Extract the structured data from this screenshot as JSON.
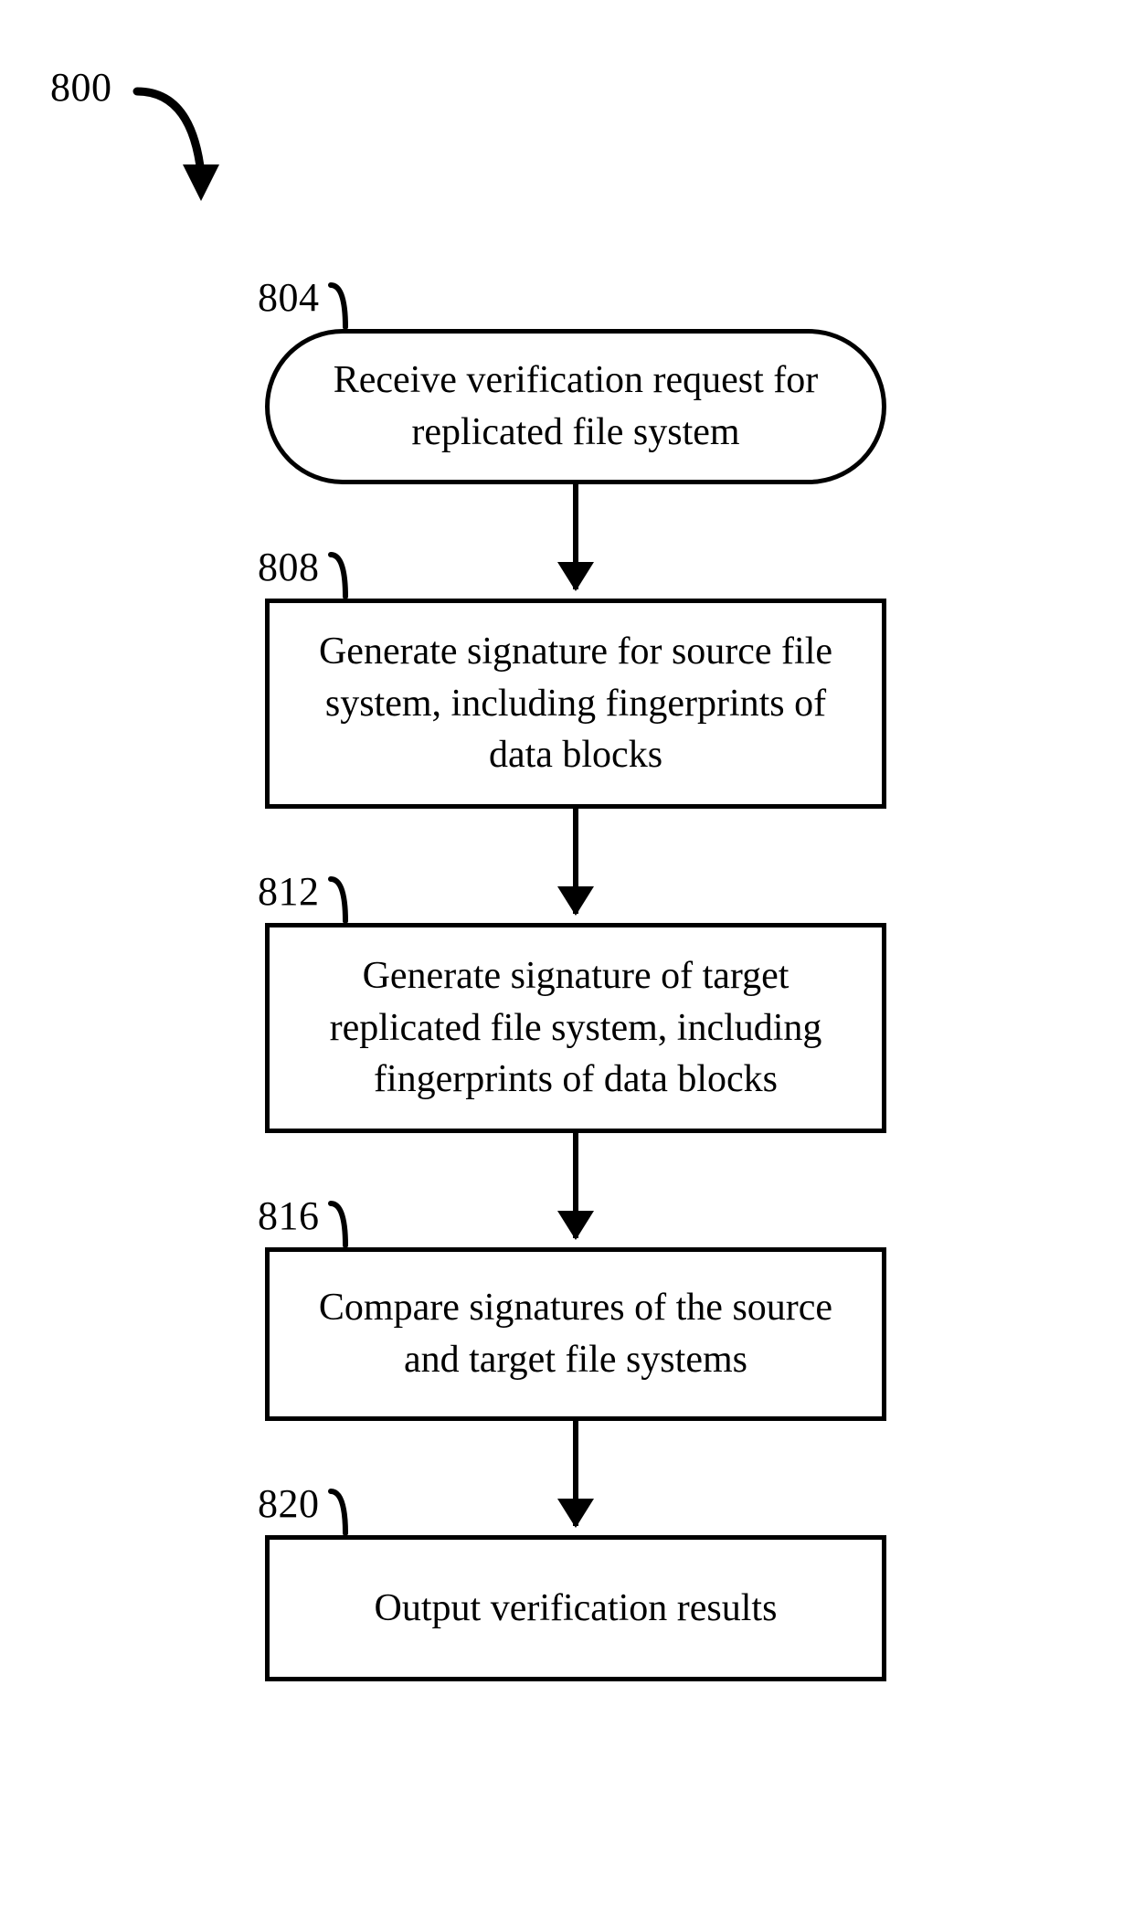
{
  "figure_ref": "800",
  "steps": [
    {
      "ref": "804",
      "shape": "terminator",
      "text": "Receive verification request for replicated file system"
    },
    {
      "ref": "808",
      "shape": "process",
      "text": "Generate signature for source file system, including fingerprints of data blocks"
    },
    {
      "ref": "812",
      "shape": "process",
      "text": "Generate signature of target replicated file system, including fingerprints of data blocks"
    },
    {
      "ref": "816",
      "shape": "process",
      "text": "Compare signatures of the source and target file systems"
    },
    {
      "ref": "820",
      "shape": "process",
      "text": "Output verification results"
    }
  ]
}
